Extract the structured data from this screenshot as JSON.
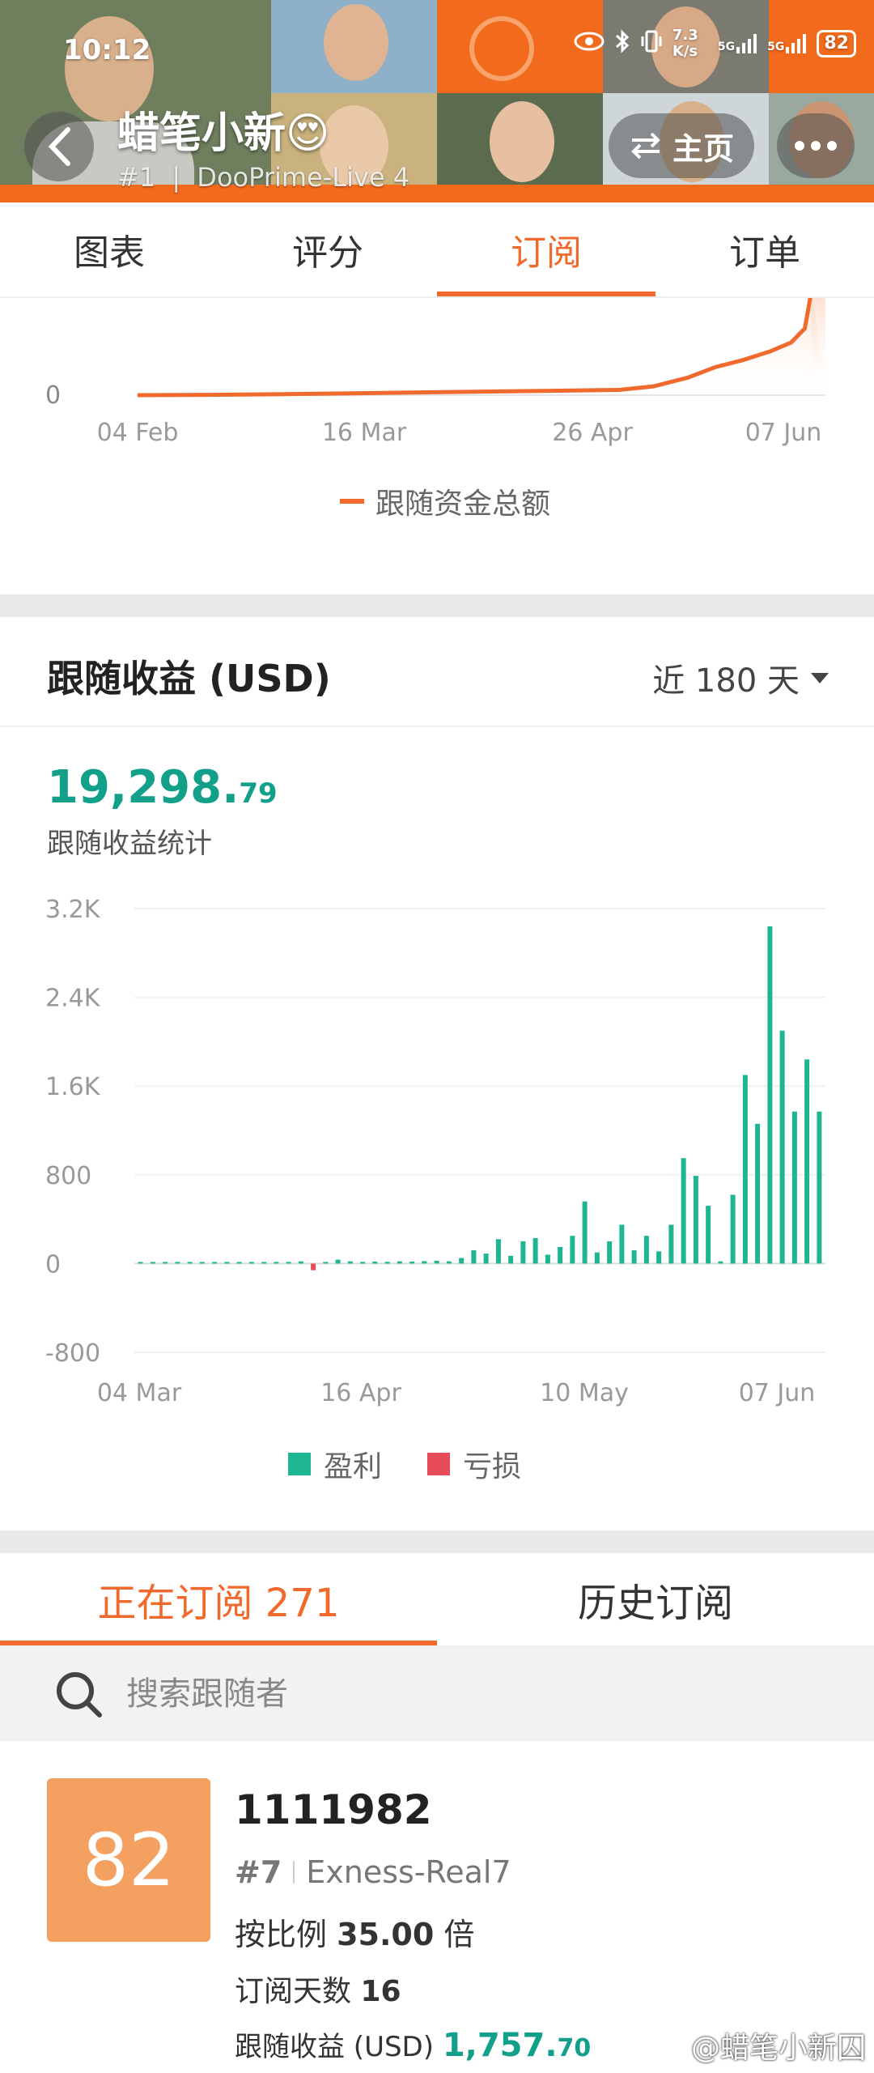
{
  "status_bar": {
    "time": "10:12",
    "net_speed": "7.3 K/s",
    "signal_1": "5G",
    "signal_2": "5G",
    "battery": "82"
  },
  "header": {
    "trader_name": "蜡笔小新😍",
    "rank": "#1",
    "account": "DooPrime-Live 4",
    "home_label": "主页"
  },
  "tabs": [
    {
      "label": "图表"
    },
    {
      "label": "评分"
    },
    {
      "label": "订阅"
    },
    {
      "label": "订单"
    }
  ],
  "fund_chart": {
    "legend": "跟随资金总额",
    "y_tick": "0",
    "x_ticks": [
      "04 Feb",
      "16 Mar",
      "26 Apr",
      "07 Jun"
    ]
  },
  "profit": {
    "title": "跟随收益 (USD)",
    "range": "近 180 天",
    "total_main": "19,298.",
    "total_decimal": "79",
    "total_label": "跟随收益统计",
    "legend_profit": "盈利",
    "legend_loss": "亏损"
  },
  "chart_data": [
    {
      "type": "line",
      "series": [
        {
          "name": "跟随资金总额",
          "color": "#ef6a2c"
        }
      ],
      "x_ticks": [
        "04 Feb",
        "16 Mar",
        "26 Apr",
        "07 Jun"
      ],
      "y_ticks": [
        "0"
      ],
      "x": [
        0,
        10,
        20,
        30,
        40,
        50,
        60,
        70,
        75,
        80,
        84,
        88,
        92,
        95,
        97,
        98
      ],
      "values": [
        0,
        0.2,
        0.5,
        1,
        1.5,
        2,
        2.5,
        3,
        5,
        10,
        16,
        20,
        25,
        30,
        38,
        60
      ]
    },
    {
      "type": "bar",
      "title": "跟随收益 (USD)",
      "y_ticks": [
        "3.2K",
        "2.4K",
        "1.6K",
        "800",
        "0",
        "-800"
      ],
      "ylim": [
        -800,
        3200
      ],
      "x_ticks": [
        "04 Mar",
        "16 Apr",
        "10 May",
        "07 Jun"
      ],
      "series": [
        {
          "name": "盈利",
          "color": "#1db592"
        },
        {
          "name": "亏损",
          "color": "#e84c5a"
        }
      ],
      "values": [
        5,
        8,
        6,
        10,
        6,
        9,
        5,
        8,
        6,
        7,
        5,
        6,
        12,
        20,
        -60,
        15,
        35,
        20,
        15,
        18,
        16,
        20,
        18,
        22,
        25,
        20,
        50,
        120,
        90,
        220,
        70,
        200,
        230,
        80,
        150,
        250,
        560,
        100,
        200,
        350,
        120,
        250,
        110,
        350,
        950,
        790,
        520,
        20,
        620,
        1700,
        1260,
        3040,
        2100,
        1370,
        1840,
        1370
      ]
    }
  ],
  "subscription": {
    "tab_current": "正在订阅 271",
    "tab_history": "历史订阅",
    "search_placeholder": "搜索跟随者"
  },
  "follower": {
    "score": "82",
    "id": "1111982",
    "rank": "#7",
    "account": "Exness-Real7",
    "ratio_prefix": "按比例",
    "ratio_value": "35.00",
    "ratio_suffix": "倍",
    "days_label": "订阅天数",
    "days_value": "16",
    "income_label": "跟随收益 (USD)",
    "income_main": "1,757.",
    "income_decimal": "70"
  },
  "watermark": "@蜡笔小新囚"
}
